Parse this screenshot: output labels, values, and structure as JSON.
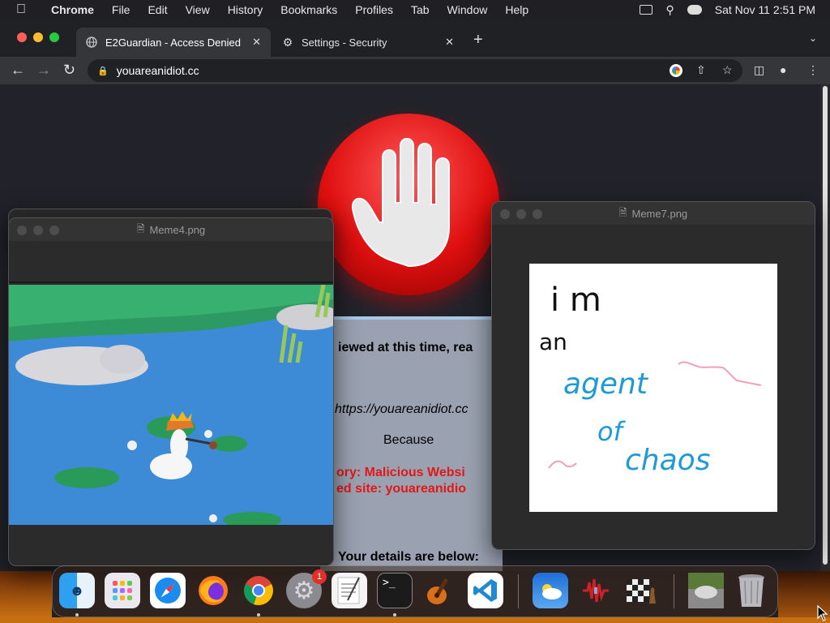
{
  "menubar": {
    "app": "Chrome",
    "items": [
      "File",
      "Edit",
      "View",
      "History",
      "Bookmarks",
      "Profiles",
      "Tab",
      "Window",
      "Help"
    ],
    "clock": "Sat Nov 11  2:51 PM"
  },
  "tabs": [
    {
      "title": "E2Guardian - Access Denied",
      "icon": "globe-icon"
    },
    {
      "title": "Settings - Security",
      "icon": "gear-icon"
    }
  ],
  "omnibox": {
    "url": "youareanidiot.cc"
  },
  "page": {
    "line1": "iewed at this time, rea",
    "url": "https://youareanidiot.cc",
    "because": "Because",
    "category": "ory: Malicious Websi",
    "site": "ed site: youareanidio",
    "details": "Your details are below:"
  },
  "windows": {
    "meme4": {
      "title": "Meme4.png"
    },
    "meme7": {
      "title": "Meme7.png",
      "drawing": {
        "line1": "i m",
        "line2": "an",
        "line3": "agent",
        "line4": "of",
        "line5": "chaos"
      }
    }
  },
  "dock": {
    "apps": [
      {
        "name": "finder",
        "running": true
      },
      {
        "name": "launchpad",
        "running": false
      },
      {
        "name": "safari",
        "running": false
      },
      {
        "name": "firefox",
        "running": false
      },
      {
        "name": "chrome",
        "running": true
      },
      {
        "name": "system-settings",
        "running": false,
        "badge": "1"
      },
      {
        "name": "textedit",
        "running": false
      },
      {
        "name": "terminal",
        "running": true
      },
      {
        "name": "garageband",
        "running": false
      },
      {
        "name": "vscode",
        "running": false
      },
      {
        "name": "weather",
        "running": false
      },
      {
        "name": "audio-app",
        "running": false
      },
      {
        "name": "chess",
        "running": false
      },
      {
        "name": "downloads-stack",
        "running": false
      },
      {
        "name": "trash",
        "running": false
      }
    ]
  },
  "colors": {
    "chrome_dark": "#202124",
    "toolbar": "#35363a",
    "stop_red": "#e01010",
    "alert_red": "#e01818",
    "drawing_blue": "#1e9ad6",
    "drawing_pink": "#f0a0b8"
  }
}
